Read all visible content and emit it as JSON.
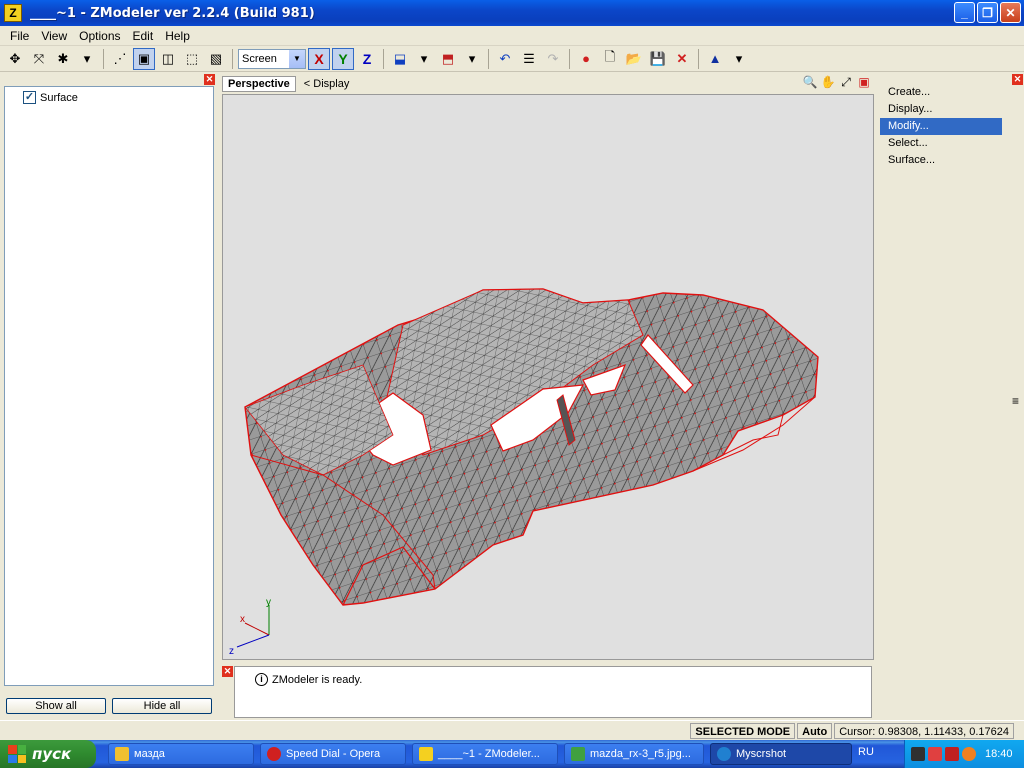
{
  "window": {
    "title": "____~1 - ZModeler ver 2.2.4 (Build 981)",
    "app_icon": "Z",
    "minimize": "_",
    "restore": "❐",
    "close": "✕"
  },
  "menu": [
    "File",
    "View",
    "Options",
    "Edit",
    "Help"
  ],
  "toolbar": {
    "mode_combo": "Screen",
    "axes": [
      "X",
      "Y",
      "Z"
    ]
  },
  "left_panel": {
    "items": [
      {
        "label": "Surface",
        "checked": true
      }
    ],
    "show_all": "Show all",
    "hide_all": "Hide all"
  },
  "viewport": {
    "tab": "Perspective",
    "sub": "< Display",
    "gizmo": {
      "x": "x",
      "y": "y",
      "z": "z"
    }
  },
  "right_panel": {
    "items": [
      "Create...",
      "Display...",
      "Modify...",
      "Select...",
      "Surface..."
    ],
    "selected": "Modify..."
  },
  "log": {
    "message": "ZModeler is ready.",
    "info_icon": "i"
  },
  "status": {
    "mode": "SELECTED MODE",
    "auto": "Auto",
    "cursor": "Cursor: 0.98308, 1.11433, 0.17624"
  },
  "taskbar": {
    "start": "пуск",
    "tasks": [
      {
        "label": "мазда",
        "icon_color": "#f0c030"
      },
      {
        "label": "Speed Dial - Opera",
        "icon_color": "#d02020"
      },
      {
        "label": "____~1 - ZModeler...",
        "icon_color": "#f4d020"
      },
      {
        "label": "mazda_rx-3_r5.jpg...",
        "icon_color": "#40a040"
      },
      {
        "label": "Myscrshot",
        "icon_color": "#2080d0"
      }
    ],
    "lang": "RU",
    "clock": "18:40"
  },
  "colors": {
    "title_blue": "#0a46c8",
    "selection": "#316ac5",
    "mesh_red": "#e01010",
    "mesh_fill": "#8a8a8a"
  }
}
